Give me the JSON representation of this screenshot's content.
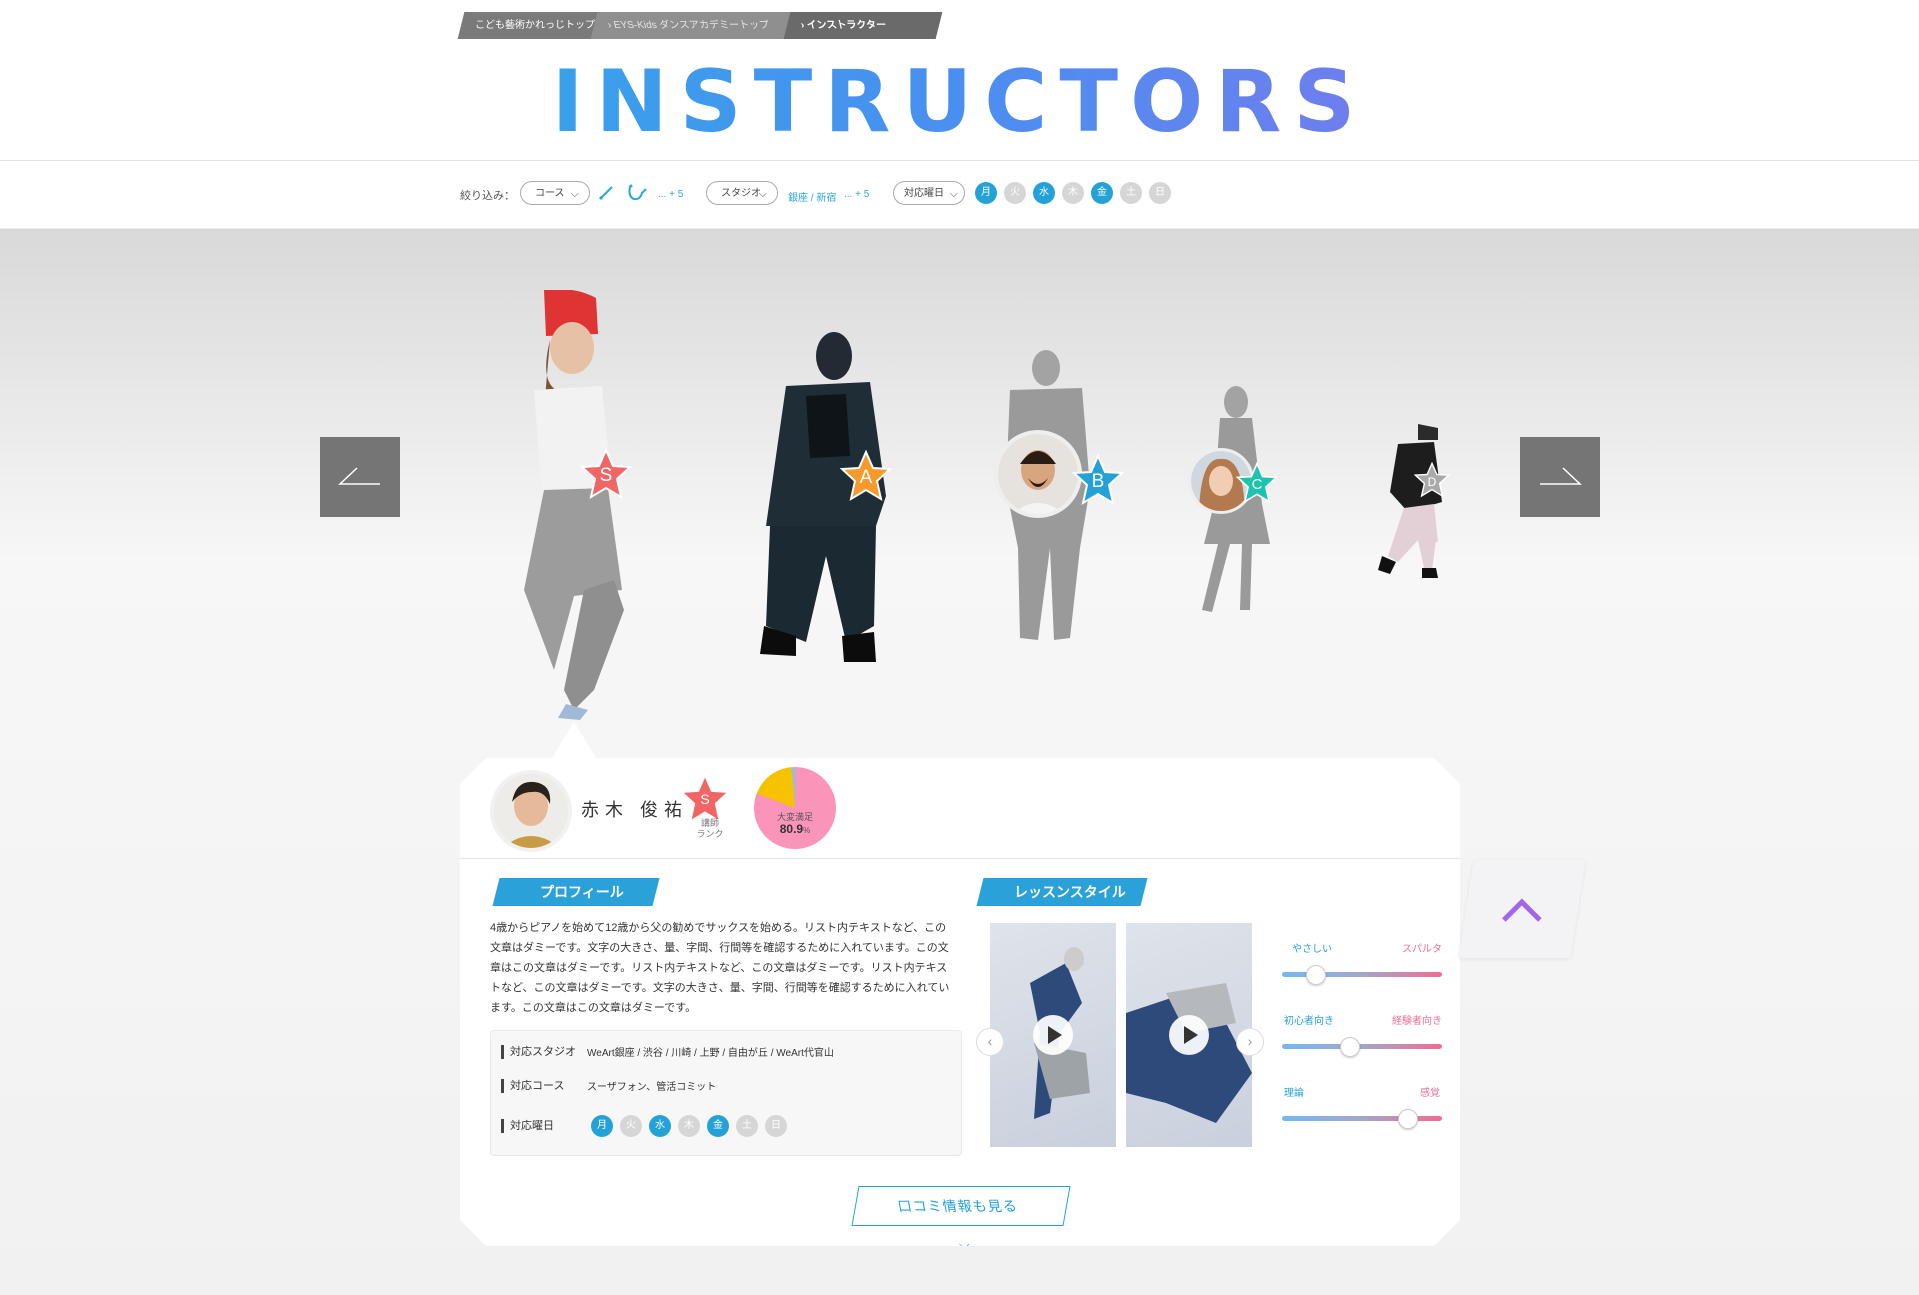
{
  "breadcrumb": {
    "items": [
      "こども藝術かれっじトップ",
      "EYS-Kids ダンスアカデミートップ",
      "インストラクター"
    ]
  },
  "page_title": "INSTRUCTORS",
  "filter": {
    "label": "絞り込み：",
    "course_select": "コース",
    "course_more": "... + 5",
    "studio_select": "スタジオ",
    "studio_value": "銀座 / 新宿",
    "studio_more": "... + 5",
    "day_select": "対応曜日",
    "days": [
      {
        "label": "月",
        "active": true
      },
      {
        "label": "火",
        "active": false
      },
      {
        "label": "水",
        "active": true
      },
      {
        "label": "木",
        "active": false
      },
      {
        "label": "金",
        "active": true
      },
      {
        "label": "土",
        "active": false
      },
      {
        "label": "日",
        "active": false
      }
    ]
  },
  "carousel": {
    "prev_icon": "arrow-left-icon",
    "next_icon": "arrow-right-icon",
    "instructors": [
      {
        "rank": "S",
        "rank_color": "#f26565"
      },
      {
        "rank": "A",
        "rank_color": "#f79a2b"
      },
      {
        "rank": "B",
        "rank_color": "#24a2d8"
      },
      {
        "rank": "C",
        "rank_color": "#1cc3ad"
      },
      {
        "rank": "D",
        "rank_color": "#aaaaaa"
      }
    ]
  },
  "selected": {
    "name": "赤木 俊祐",
    "rank": "S",
    "rank_label": "講師\nランク",
    "satisfaction_label": "大変満足",
    "satisfaction_value": "80.9",
    "satisfaction_unit": "%",
    "profile_heading": "プロフィール",
    "profile_text": "4歳からピアノを始めて12歳から父の勧めでサックスを始める。リスト内テキストなど、この文章はダミーです。文字の大きさ、量、字間、行間等を確認するために入れています。この文章はこの文章はダミーです。リスト内テキストなど、この文章はダミーです。リスト内テキストなど、この文章はダミーです。文字の大きさ、量、字間、行間等を確認するために入れています。この文章はこの文章はダミーです。",
    "info": {
      "studio_label": "対応スタジオ",
      "studio_value": "WeArt銀座 / 渋谷 / 川崎 / 上野 / 自由が丘 / WeArt代官山",
      "course_label": "対応コース",
      "course_value": "スーザフォン、管活コミット",
      "day_label": "対応曜日"
    },
    "lesson_heading": "レッスンスタイル",
    "sliders": [
      {
        "left": "やさしい",
        "right": "スパルタ",
        "value": 0.2
      },
      {
        "left": "初心者向き",
        "right": "経験者向き",
        "value": 0.42
      },
      {
        "left": "理論",
        "right": "感覚",
        "value": 0.78
      }
    ],
    "reviews_button": "口コミ情報も見る"
  },
  "colors": {
    "accent": "#24a2d8",
    "purple": "#a266ea",
    "pink": "#f16d92"
  }
}
